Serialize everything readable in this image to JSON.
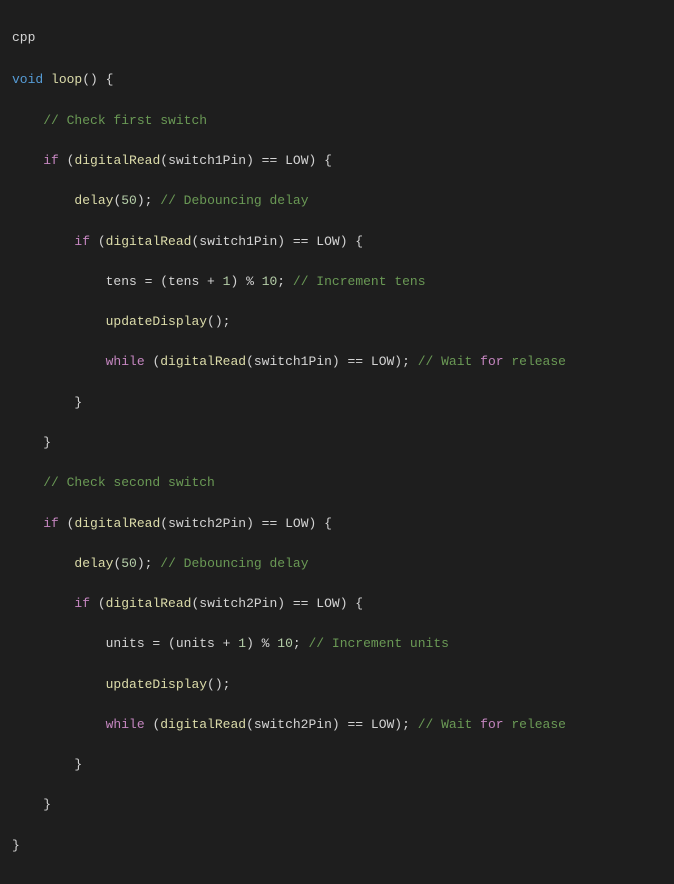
{
  "lang_label": "cpp",
  "code": {
    "l1_kw": "void",
    "l1_fn": "loop",
    "l1_rest": "() {",
    "l2_ind": "    ",
    "l2_c": "// Check first switch",
    "l3_ind": "    ",
    "l3_kw": "if",
    "l3_open": " (",
    "l3_fn": "digitalRead",
    "l3_arg": "(switch1Pin) == LOW) {",
    "l4_ind": "        ",
    "l4_fn": "delay",
    "l4_open": "(",
    "l4_num": "50",
    "l4_close": "); ",
    "l4_c": "// Debouncing delay",
    "l5_ind": "        ",
    "l5_kw": "if",
    "l5_open": " (",
    "l5_fn": "digitalRead",
    "l5_arg": "(switch1Pin) == LOW) {",
    "l6_ind": "            ",
    "l6_lhs": "tens = (tens + ",
    "l6_n1": "1",
    "l6_mid": ") % ",
    "l6_n2": "10",
    "l6_end": "; ",
    "l6_c": "// Increment tens",
    "l7_ind": "            ",
    "l7_fn": "updateDisplay",
    "l7_end": "();",
    "l8_ind": "            ",
    "l8_kw": "while",
    "l8_open": " (",
    "l8_fn": "digitalRead",
    "l8_arg": "(switch1Pin) == LOW); ",
    "l8_c1": "// Wait ",
    "l8_kw2": "for",
    "l8_c2": " release",
    "l9_ind": "        ",
    "l9_b": "}",
    "l10_ind": "    ",
    "l10_b": "}",
    "l11_ind": "    ",
    "l11_c": "// Check second switch",
    "l12_ind": "    ",
    "l12_kw": "if",
    "l12_open": " (",
    "l12_fn": "digitalRead",
    "l12_arg": "(switch2Pin) == LOW) {",
    "l13_ind": "        ",
    "l13_fn": "delay",
    "l13_open": "(",
    "l13_num": "50",
    "l13_close": "); ",
    "l13_c": "// Debouncing delay",
    "l14_ind": "        ",
    "l14_kw": "if",
    "l14_open": " (",
    "l14_fn": "digitalRead",
    "l14_arg": "(switch2Pin) == LOW) {",
    "l15_ind": "            ",
    "l15_lhs": "units = (units + ",
    "l15_n1": "1",
    "l15_mid": ") % ",
    "l15_n2": "10",
    "l15_end": "; ",
    "l15_c": "// Increment units",
    "l16_ind": "            ",
    "l16_fn": "updateDisplay",
    "l16_end": "();",
    "l17_ind": "            ",
    "l17_kw": "while",
    "l17_open": " (",
    "l17_fn": "digitalRead",
    "l17_arg": "(switch2Pin) == LOW); ",
    "l17_c1": "// Wait ",
    "l17_kw2": "for",
    "l17_c2": " release",
    "l18_ind": "        ",
    "l18_b": "}",
    "l19_ind": "    ",
    "l19_b": "}",
    "l20_b": "}"
  }
}
